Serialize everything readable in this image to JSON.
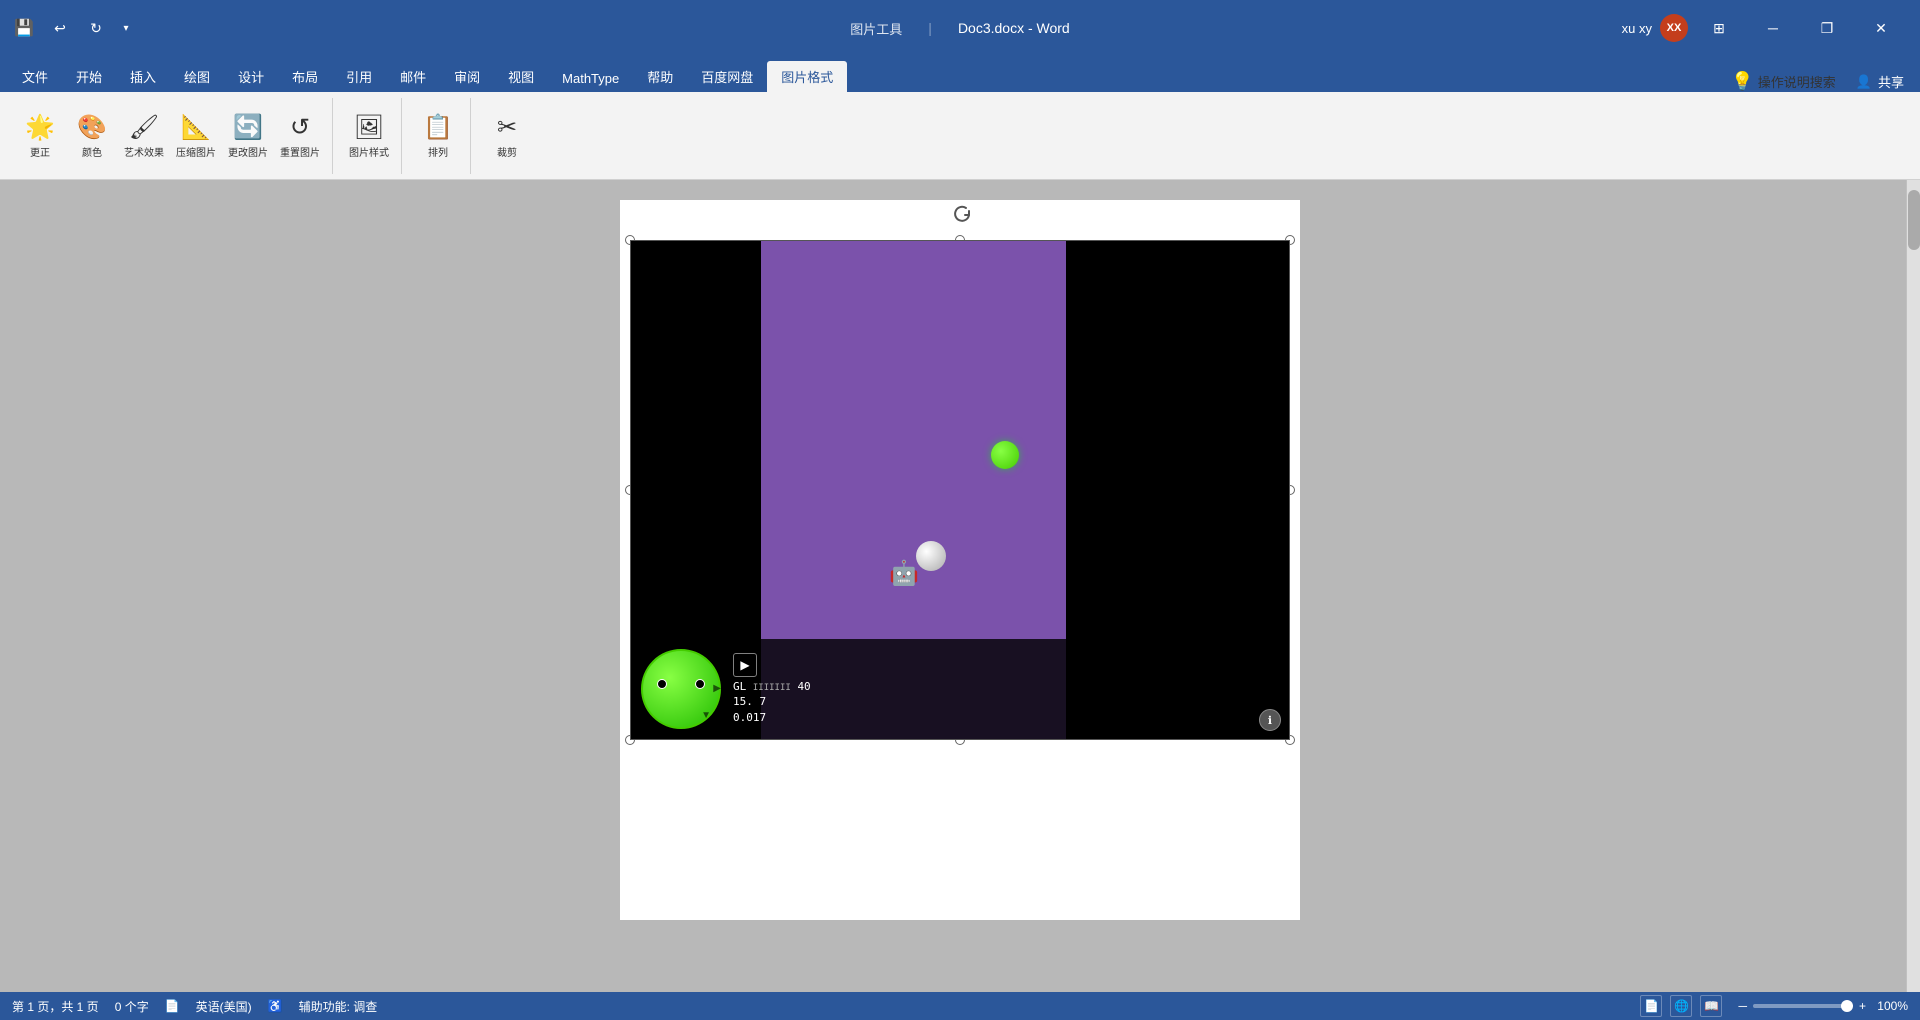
{
  "app": {
    "title": "Doc3.docx  -  Word",
    "app_name": "Word",
    "tool_label": "图片工具"
  },
  "titlebar": {
    "save_label": "💾",
    "undo_label": "↩",
    "redo_label": "↻",
    "more_label": "▾",
    "user_name": "xu xy",
    "user_initials": "XX",
    "minimize": "─",
    "restore": "❐",
    "close": "✕"
  },
  "menu": {
    "tabs": [
      "文件",
      "开始",
      "插入",
      "绘图",
      "设计",
      "布局",
      "引用",
      "邮件",
      "审阅",
      "视图",
      "MathType",
      "帮助",
      "百度网盘",
      "图片格式"
    ],
    "active_tab": "图片格式",
    "help_icon": "💡",
    "help_search": "操作说明搜索",
    "share_icon": "👤",
    "share_label": "共享"
  },
  "statusbar": {
    "page_info": "第 1 页，共 1 页",
    "word_count": "0 个字",
    "proofing_icon": "📄",
    "language": "英语(美国)",
    "accessibility_icon": "♿",
    "accessibility": "辅助功能: 调查",
    "zoom_level": "100%"
  },
  "game_ui": {
    "stats_line1": "GL",
    "stats_line2": "15.",
    "stats_num": "40",
    "stats_num2": "7",
    "stats_time": "0.017"
  }
}
